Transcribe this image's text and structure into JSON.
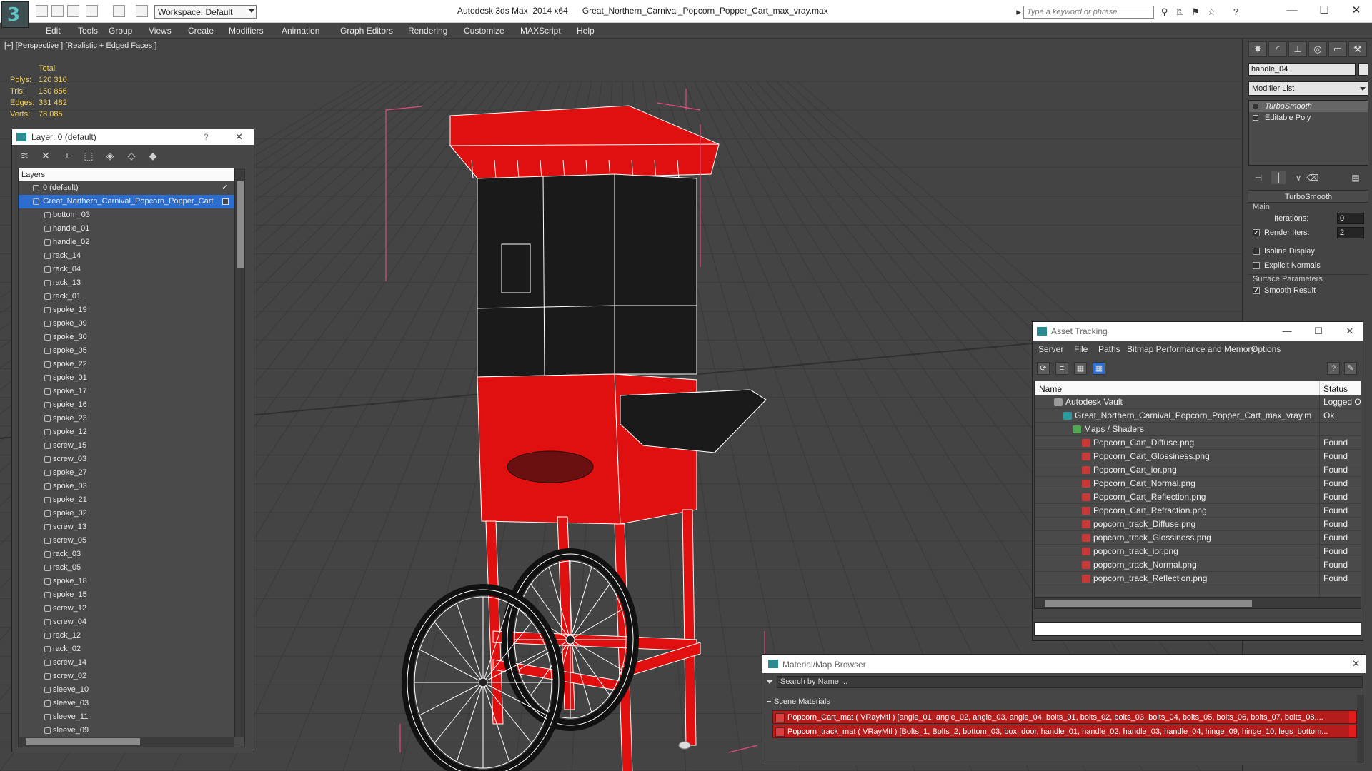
{
  "app": {
    "logo_glyph": "3",
    "workspace": "Workspace: Default",
    "title": "Autodesk 3ds Max  2014 x64      Great_Northern_Carnival_Popcorn_Popper_Cart_max_vray.max",
    "search_placeholder": "Type a keyword or phrase",
    "accent": "#2c6dcd",
    "window_buttons": {
      "minimize": "—",
      "maximize": "☐",
      "close": "✕"
    }
  },
  "menu": [
    "Edit",
    "Tools",
    "Group",
    "Views",
    "Create",
    "Modifiers",
    "Animation",
    "Graph Editors",
    "Rendering",
    "Customize",
    "MAXScript",
    "Help"
  ],
  "viewport": {
    "label": "[+] [Perspective ] [Realistic + Edged Faces ]",
    "stats": {
      "header": "Total",
      "rows": [
        {
          "k": "Polys:",
          "v": "120 310"
        },
        {
          "k": "Tris:",
          "v": "150 856"
        },
        {
          "k": "Edges:",
          "v": "331 482"
        },
        {
          "k": "Verts:",
          "v": "78 085"
        }
      ]
    },
    "model_colors": {
      "body": "#e01010",
      "dark": "#1a1a1a",
      "wire": "#ffffff"
    }
  },
  "layer_panel": {
    "title": "Layer: 0 (default)",
    "help": "?",
    "close": "✕",
    "header": "Layers",
    "top_layers": [
      {
        "name": "0 (default)",
        "checked": "✓"
      },
      {
        "name": "Great_Northern_Carnival_Popcorn_Popper_Cart",
        "selected": true
      }
    ],
    "objects": [
      "bottom_03",
      "handle_01",
      "handle_02",
      "rack_14",
      "rack_04",
      "rack_13",
      "rack_01",
      "spoke_19",
      "spoke_09",
      "spoke_30",
      "spoke_05",
      "spoke_22",
      "spoke_01",
      "spoke_17",
      "spoke_16",
      "spoke_23",
      "spoke_12",
      "screw_15",
      "screw_03",
      "spoke_27",
      "spoke_03",
      "spoke_21",
      "spoke_02",
      "screw_13",
      "screw_05",
      "rack_03",
      "rack_05",
      "spoke_18",
      "spoke_15",
      "screw_12",
      "screw_04",
      "rack_12",
      "rack_02",
      "screw_14",
      "screw_02",
      "sleeve_10",
      "sleeve_03",
      "sleeve_11",
      "sleeve_09"
    ]
  },
  "command_panel": {
    "object_name": "handle_04",
    "modifier_list": "Modifier List",
    "stack": [
      {
        "name": "TurboSmooth",
        "selected": true
      },
      {
        "name": "Editable Poly",
        "selected": false
      }
    ],
    "turbosmooth": {
      "title": "TurboSmooth",
      "main": "Main",
      "iterations_label": "Iterations:",
      "iterations": "0",
      "render_iters_label": "Render Iters:",
      "render_iters": "2",
      "isoline": "Isoline Display",
      "explicit": "Explicit Normals",
      "surface": "Surface Parameters",
      "smooth": "Smooth Result"
    }
  },
  "asset_tracking": {
    "title": "Asset Tracking",
    "menu": [
      "Server",
      "File",
      "Paths",
      "Bitmap Performance and Memory",
      "Options"
    ],
    "columns": {
      "name": "Name",
      "status": "Status"
    },
    "rows": [
      {
        "name": "Autodesk Vault",
        "status": "Logged O",
        "indent": 1,
        "icon": "vault"
      },
      {
        "name": "Great_Northern_Carnival_Popcorn_Popper_Cart_max_vray.max",
        "status": "Ok",
        "indent": 2,
        "icon": "max"
      },
      {
        "name": "Maps / Shaders",
        "status": "",
        "indent": 3,
        "icon": "maps"
      },
      {
        "name": "Popcorn_Cart_Diffuse.png",
        "status": "Found",
        "indent": 4,
        "icon": "png"
      },
      {
        "name": "Popcorn_Cart_Glossiness.png",
        "status": "Found",
        "indent": 4,
        "icon": "png"
      },
      {
        "name": "Popcorn_Cart_ior.png",
        "status": "Found",
        "indent": 4,
        "icon": "png"
      },
      {
        "name": "Popcorn_Cart_Normal.png",
        "status": "Found",
        "indent": 4,
        "icon": "png"
      },
      {
        "name": "Popcorn_Cart_Reflection.png",
        "status": "Found",
        "indent": 4,
        "icon": "png"
      },
      {
        "name": "Popcorn_Cart_Refraction.png",
        "status": "Found",
        "indent": 4,
        "icon": "png"
      },
      {
        "name": "popcorn_track_Diffuse.png",
        "status": "Found",
        "indent": 4,
        "icon": "png"
      },
      {
        "name": "popcorn_track_Glossiness.png",
        "status": "Found",
        "indent": 4,
        "icon": "png"
      },
      {
        "name": "popcorn_track_ior.png",
        "status": "Found",
        "indent": 4,
        "icon": "png"
      },
      {
        "name": "popcorn_track_Normal.png",
        "status": "Found",
        "indent": 4,
        "icon": "png"
      },
      {
        "name": "popcorn_track_Reflection.png",
        "status": "Found",
        "indent": 4,
        "icon": "png"
      }
    ]
  },
  "material_browser": {
    "title": "Material/Map Browser",
    "search_placeholder": "Search by Name ...",
    "group": "Scene Materials",
    "materials": [
      "Popcorn_Cart_mat  ( VRayMtl ) [angle_01, angle_02, angle_03, angle_04, bolts_01, bolts_02, bolts_03, bolts_04, bolts_05, bolts_06, bolts_07, bolts_08,...",
      "Popcorn_track_mat  ( VRayMtl ) [Bolts_1, Bolts_2, bottom_03, box, door, handle_01, handle_02, handle_03, handle_04, hinge_09, hinge_10, legs_bottom..."
    ]
  }
}
